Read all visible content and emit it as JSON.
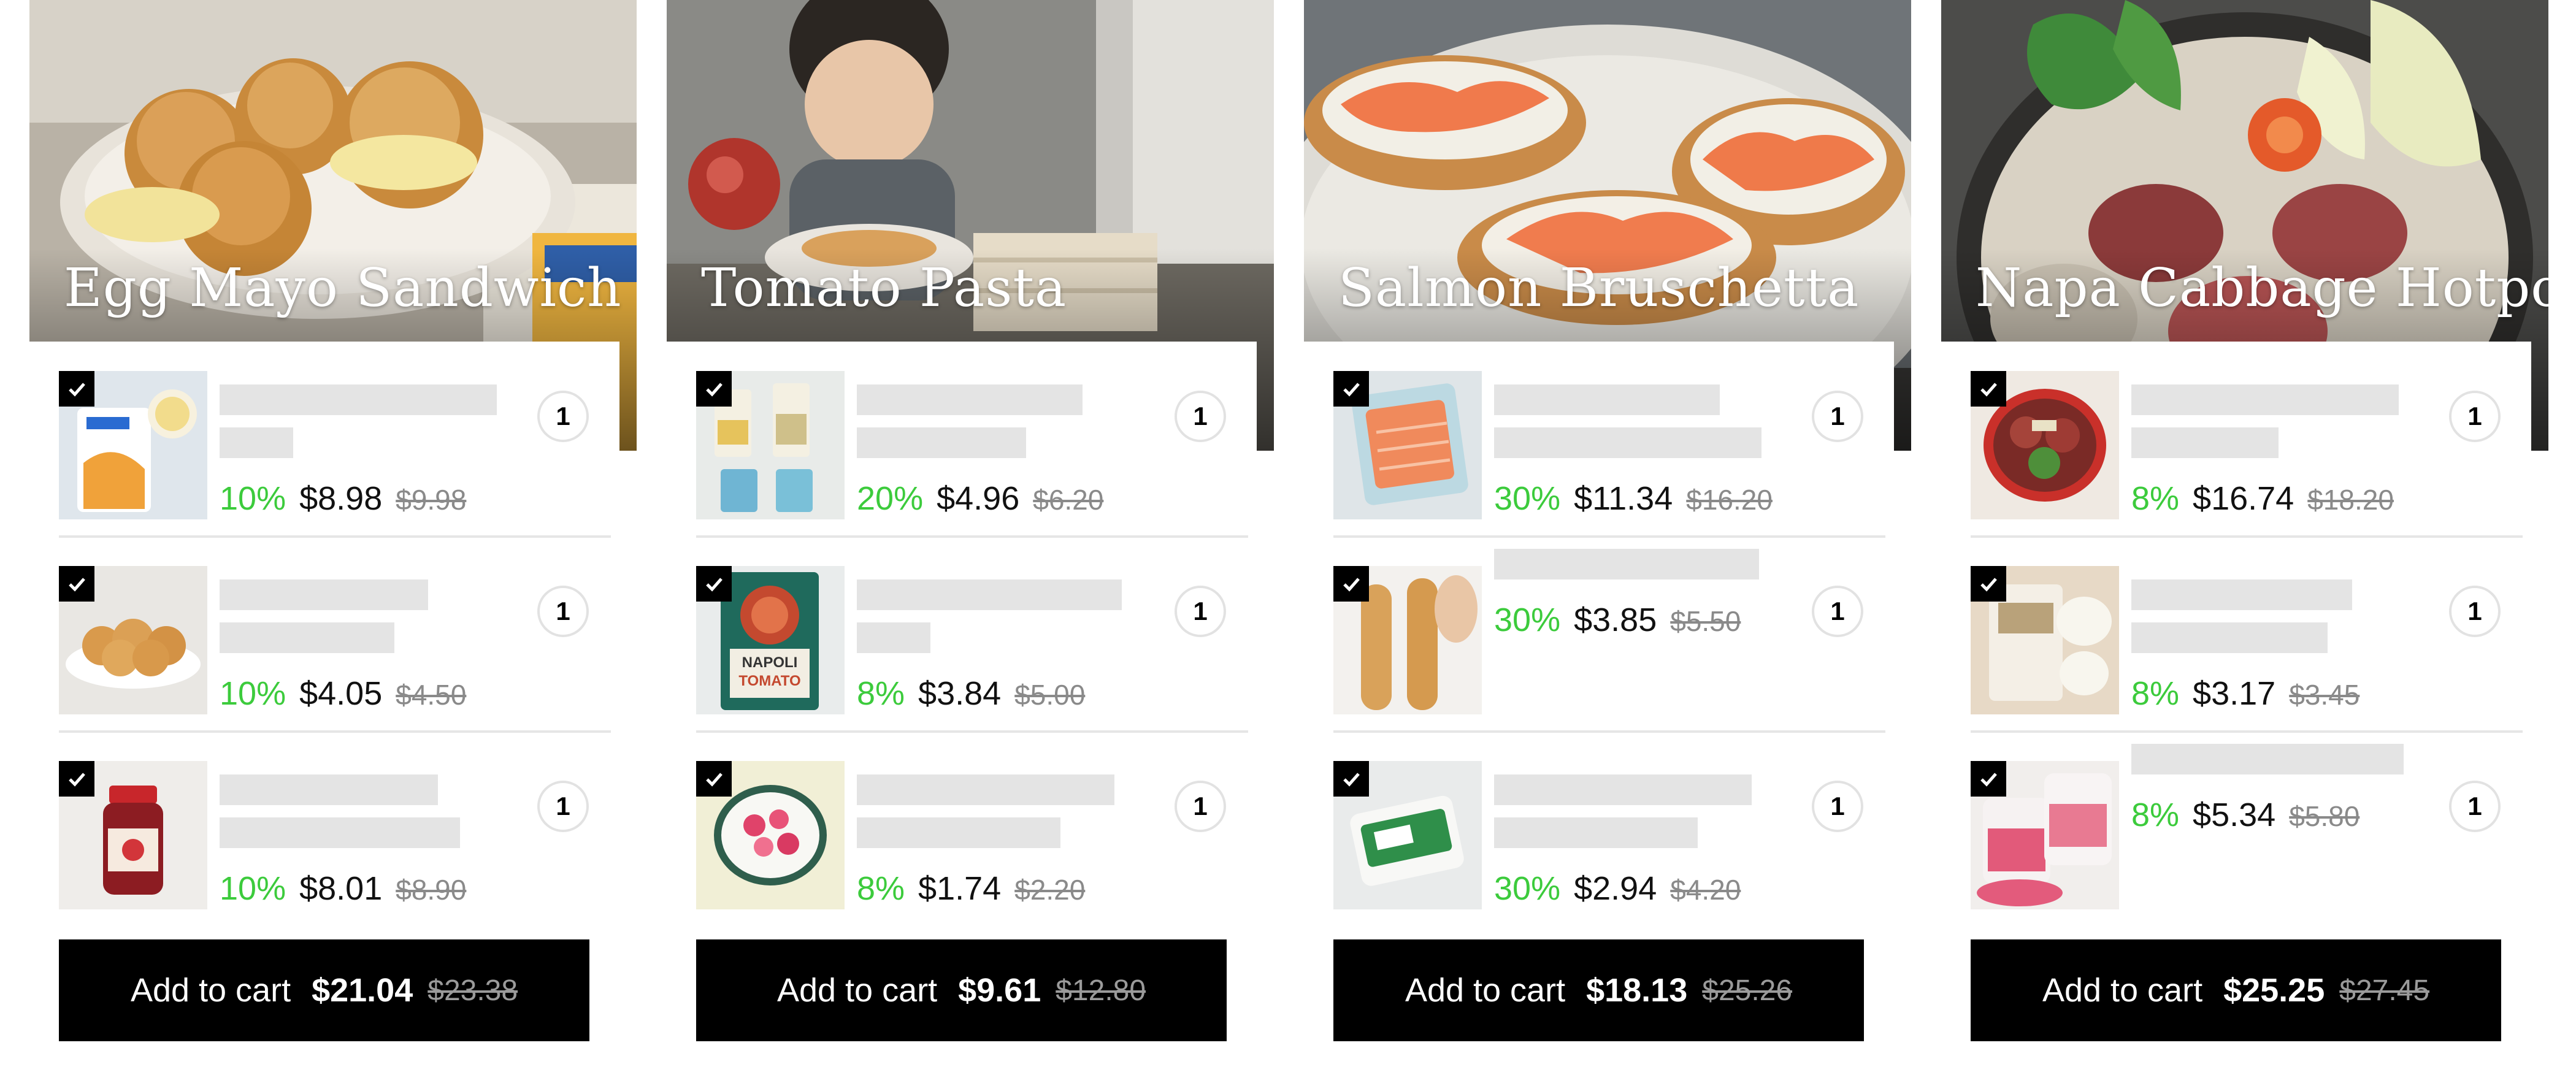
{
  "colors": {
    "discount": "#3ccb3c",
    "button_bg": "#000000",
    "skeleton": "#e4e4e4"
  },
  "cards": [
    {
      "title": "Egg Mayo Sandwich",
      "items": [
        {
          "discount": "10%",
          "price": "$8.98",
          "original": "$9.98",
          "qty": "1",
          "thumb": "seasoning-pouch"
        },
        {
          "discount": "10%",
          "price": "$4.05",
          "original": "$4.50",
          "qty": "1",
          "thumb": "bread-rolls"
        },
        {
          "discount": "10%",
          "price": "$8.01",
          "original": "$8.90",
          "qty": "1",
          "thumb": "jam-jar"
        }
      ],
      "cart": {
        "label": "Add to cart",
        "total": "$21.04",
        "original": "$23.38"
      }
    },
    {
      "title": "Tomato Pasta",
      "items": [
        {
          "discount": "20%",
          "price": "$4.96",
          "original": "$6.20",
          "qty": "1",
          "thumb": "pasta-packs"
        },
        {
          "discount": "8%",
          "price": "$3.84",
          "original": "$5.00",
          "qty": "1",
          "thumb": "napoli-tomato-sauce",
          "pack_label_1": "NAPOLI",
          "pack_label_2": "TOMATO"
        },
        {
          "discount": "8%",
          "price": "$1.74",
          "original": "$2.20",
          "qty": "1",
          "thumb": "radish-bowl"
        }
      ],
      "cart": {
        "label": "Add to cart",
        "total": "$9.61",
        "original": "$12.80"
      }
    },
    {
      "title": "Salmon Bruschetta",
      "items": [
        {
          "discount": "30%",
          "price": "$11.34",
          "original": "$16.20",
          "qty": "1",
          "thumb": "salmon-slices"
        },
        {
          "discount": "30%",
          "price": "$3.85",
          "original": "$5.50",
          "qty": "1",
          "thumb": "baguette"
        },
        {
          "discount": "30%",
          "price": "$2.94",
          "original": "$4.20",
          "qty": "1",
          "thumb": "cream-cheese"
        }
      ],
      "cart": {
        "label": "Add to cart",
        "total": "$18.13",
        "original": "$25.26"
      }
    },
    {
      "title": "Napa Cabbage Hotpot",
      "items": [
        {
          "discount": "8%",
          "price": "$16.74",
          "original": "$18.20",
          "qty": "1",
          "thumb": "hotpot-pan"
        },
        {
          "discount": "8%",
          "price": "$3.17",
          "original": "$3.45",
          "qty": "1",
          "thumb": "noodle-pack"
        },
        {
          "discount": "8%",
          "price": "$5.34",
          "original": "$5.80",
          "qty": "1",
          "thumb": "pickled-radish-tubs"
        }
      ],
      "cart": {
        "label": "Add to cart",
        "total": "$25.25",
        "original": "$27.45"
      }
    }
  ]
}
